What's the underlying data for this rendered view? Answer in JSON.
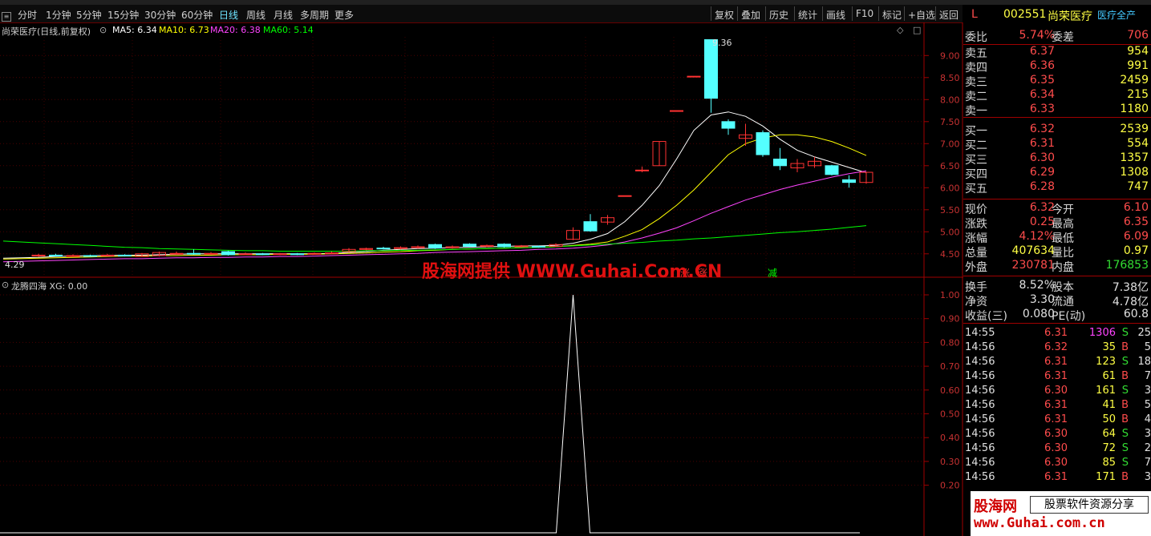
{
  "toolbar": {
    "periods": [
      "分时",
      "1分钟",
      "5分钟",
      "15分钟",
      "30分钟",
      "60分钟",
      "日线",
      "周线",
      "月线",
      "多周期",
      "更多"
    ],
    "active": "日线",
    "right_buttons": [
      "复权",
      "叠加",
      "历史",
      "统计",
      "画线",
      "F10",
      "标记",
      "+自选",
      "返回"
    ]
  },
  "main": {
    "title": "尚荣医疗(日线,前复权)",
    "ma": [
      {
        "label": "MA5: 6.34",
        "color": "#ffffff"
      },
      {
        "label": "MA10: 6.73",
        "color": "#ffff00"
      },
      {
        "label": "MA20: 6.38",
        "color": "#ff44ff"
      },
      {
        "label": "MA60: 5.14",
        "color": "#00ff00"
      }
    ],
    "high_label": "9.36",
    "low_label": "4.29",
    "markers": [
      {
        "text": "涨",
        "color": "#ff3030"
      },
      {
        "text": "涨",
        "color": "#ff3030"
      },
      {
        "text": "减",
        "color": "#00ff00"
      }
    ],
    "watermark": "股海网提供 WWW.Guhai.Com.CN"
  },
  "sub": {
    "title": "龙腾四海 XG: 0.00",
    "yticks": [
      "1.00",
      "0.90",
      "0.80",
      "0.70",
      "0.60",
      "0.50",
      "0.40",
      "0.30",
      "0.20"
    ]
  },
  "chart_data": {
    "type": "candlestick",
    "y_ticks": [
      "9.00",
      "8.50",
      "8.00",
      "7.50",
      "7.00",
      "6.50",
      "6.00",
      "5.50",
      "5.00",
      "4.50"
    ],
    "ylim": [
      4.2,
      9.5
    ],
    "candles": [
      {
        "o": 4.46,
        "c": 4.47,
        "h": 4.5,
        "l": 4.43,
        "up": true
      },
      {
        "o": 4.47,
        "c": 4.46,
        "h": 4.5,
        "l": 4.44,
        "up": false
      },
      {
        "o": 4.45,
        "c": 4.46,
        "h": 4.49,
        "l": 4.43,
        "up": true
      },
      {
        "o": 4.46,
        "c": 4.45,
        "h": 4.48,
        "l": 4.43,
        "up": false
      },
      {
        "o": 4.45,
        "c": 4.47,
        "h": 4.5,
        "l": 4.44,
        "up": true
      },
      {
        "o": 4.47,
        "c": 4.46,
        "h": 4.49,
        "l": 4.44,
        "up": false
      },
      {
        "o": 4.44,
        "c": 4.5,
        "h": 4.52,
        "l": 4.43,
        "up": true
      },
      {
        "o": 4.46,
        "c": 4.53,
        "h": 4.55,
        "l": 4.44,
        "up": true
      },
      {
        "o": 4.5,
        "c": 4.51,
        "h": 4.55,
        "l": 4.48,
        "up": true
      },
      {
        "o": 4.51,
        "c": 4.5,
        "h": 4.6,
        "l": 4.48,
        "up": false
      },
      {
        "o": 4.5,
        "c": 4.51,
        "h": 4.54,
        "l": 4.49,
        "up": true
      },
      {
        "o": 4.55,
        "c": 4.48,
        "h": 4.57,
        "l": 4.46,
        "up": false
      },
      {
        "o": 4.49,
        "c": 4.5,
        "h": 4.53,
        "l": 4.47,
        "up": true
      },
      {
        "o": 4.5,
        "c": 4.49,
        "h": 4.52,
        "l": 4.47,
        "up": false
      },
      {
        "o": 4.49,
        "c": 4.5,
        "h": 4.52,
        "l": 4.47,
        "up": true
      },
      {
        "o": 4.5,
        "c": 4.49,
        "h": 4.52,
        "l": 4.47,
        "up": false
      },
      {
        "o": 4.49,
        "c": 4.51,
        "h": 4.53,
        "l": 4.48,
        "up": true
      },
      {
        "o": 4.5,
        "c": 4.52,
        "h": 4.55,
        "l": 4.49,
        "up": true
      },
      {
        "o": 4.55,
        "c": 4.6,
        "h": 4.63,
        "l": 4.53,
        "up": true
      },
      {
        "o": 4.6,
        "c": 4.62,
        "h": 4.64,
        "l": 4.58,
        "up": true
      },
      {
        "o": 4.63,
        "c": 4.62,
        "h": 4.66,
        "l": 4.6,
        "up": false
      },
      {
        "o": 4.62,
        "c": 4.64,
        "h": 4.67,
        "l": 4.6,
        "up": true
      },
      {
        "o": 4.66,
        "c": 4.64,
        "h": 4.69,
        "l": 4.62,
        "up": true
      },
      {
        "o": 4.71,
        "c": 4.63,
        "h": 4.73,
        "l": 4.61,
        "up": false
      },
      {
        "o": 4.64,
        "c": 4.66,
        "h": 4.69,
        "l": 4.62,
        "up": true
      },
      {
        "o": 4.72,
        "c": 4.67,
        "h": 4.74,
        "l": 4.65,
        "up": false
      },
      {
        "o": 4.67,
        "c": 4.69,
        "h": 4.71,
        "l": 4.65,
        "up": true
      },
      {
        "o": 4.72,
        "c": 4.66,
        "h": 4.74,
        "l": 4.64,
        "up": false
      },
      {
        "o": 4.66,
        "c": 4.68,
        "h": 4.7,
        "l": 4.64,
        "up": true
      },
      {
        "o": 4.67,
        "c": 4.66,
        "h": 4.69,
        "l": 4.64,
        "up": false
      },
      {
        "o": 4.67,
        "c": 4.71,
        "h": 4.74,
        "l": 4.65,
        "up": true
      },
      {
        "o": 4.83,
        "c": 5.03,
        "h": 5.1,
        "l": 4.81,
        "up": true
      },
      {
        "o": 5.23,
        "c": 5.02,
        "h": 5.4,
        "l": 5.0,
        "up": false
      },
      {
        "o": 5.22,
        "c": 5.32,
        "h": 5.38,
        "l": 5.16,
        "up": true
      },
      {
        "o": 5.82,
        "c": 5.82,
        "h": 5.82,
        "l": 5.82,
        "up": true
      },
      {
        "o": 6.4,
        "c": 6.4,
        "h": 6.48,
        "l": 6.35,
        "up": true
      },
      {
        "o": 6.5,
        "c": 7.05,
        "h": 7.05,
        "l": 6.5,
        "up": true
      },
      {
        "o": 7.75,
        "c": 7.75,
        "h": 7.75,
        "l": 7.75,
        "up": true
      },
      {
        "o": 8.53,
        "c": 8.53,
        "h": 8.53,
        "l": 8.53,
        "up": true
      },
      {
        "o": 9.36,
        "c": 8.03,
        "h": 9.36,
        "l": 7.7,
        "up": false
      },
      {
        "o": 7.5,
        "c": 7.35,
        "h": 7.55,
        "l": 7.2,
        "up": false
      },
      {
        "o": 7.12,
        "c": 7.2,
        "h": 7.45,
        "l": 6.95,
        "up": true
      },
      {
        "o": 7.25,
        "c": 6.75,
        "h": 7.3,
        "l": 6.7,
        "up": false
      },
      {
        "o": 6.65,
        "c": 6.5,
        "h": 6.9,
        "l": 6.4,
        "up": false
      },
      {
        "o": 6.45,
        "c": 6.55,
        "h": 6.65,
        "l": 6.35,
        "up": true
      },
      {
        "o": 6.5,
        "c": 6.6,
        "h": 6.7,
        "l": 6.45,
        "up": true
      },
      {
        "o": 6.5,
        "c": 6.3,
        "h": 6.52,
        "l": 6.28,
        "up": false
      },
      {
        "o": 6.18,
        "c": 6.12,
        "h": 6.28,
        "l": 6.0,
        "up": false
      },
      {
        "o": 6.12,
        "c": 6.35,
        "h": 6.35,
        "l": 6.09,
        "up": true
      }
    ],
    "ma_series": [
      {
        "name": "MA5",
        "color": "#ffffff",
        "values": [
          4.42,
          4.44,
          4.45,
          4.46,
          4.46,
          4.47,
          4.47,
          4.48,
          4.49,
          4.5,
          4.5,
          4.5,
          4.5,
          4.5,
          4.5,
          4.5,
          4.5,
          4.51,
          4.53,
          4.55,
          4.58,
          4.6,
          4.62,
          4.63,
          4.64,
          4.65,
          4.66,
          4.67,
          4.68,
          4.68,
          4.69,
          4.74,
          4.83,
          4.96,
          5.23,
          5.6,
          6.05,
          6.65,
          7.3,
          7.65,
          7.72,
          7.62,
          7.4,
          7.1,
          6.85,
          6.7,
          6.58,
          6.46,
          6.34
        ]
      },
      {
        "name": "MA10",
        "color": "#ffff00",
        "values": [
          4.4,
          4.41,
          4.42,
          4.43,
          4.44,
          4.45,
          4.45,
          4.46,
          4.46,
          4.47,
          4.47,
          4.48,
          4.48,
          4.48,
          4.49,
          4.49,
          4.49,
          4.5,
          4.51,
          4.52,
          4.54,
          4.55,
          4.57,
          4.58,
          4.6,
          4.61,
          4.62,
          4.63,
          4.64,
          4.65,
          4.66,
          4.69,
          4.72,
          4.77,
          4.9,
          5.05,
          5.3,
          5.6,
          5.95,
          6.35,
          6.75,
          7.0,
          7.13,
          7.2,
          7.2,
          7.15,
          7.05,
          6.9,
          6.73
        ]
      },
      {
        "name": "MA20",
        "color": "#ff44ff",
        "values": [
          4.34,
          4.35,
          4.36,
          4.37,
          4.38,
          4.39,
          4.39,
          4.4,
          4.41,
          4.41,
          4.42,
          4.42,
          4.43,
          4.43,
          4.44,
          4.44,
          4.45,
          4.46,
          4.47,
          4.48,
          4.49,
          4.5,
          4.51,
          4.53,
          4.54,
          4.55,
          4.56,
          4.57,
          4.58,
          4.6,
          4.61,
          4.63,
          4.66,
          4.7,
          4.77,
          4.86,
          4.97,
          5.09,
          5.25,
          5.42,
          5.57,
          5.72,
          5.84,
          5.96,
          6.06,
          6.15,
          6.24,
          6.32,
          6.38
        ]
      },
      {
        "name": "MA60",
        "color": "#00ff00",
        "values": [
          4.75,
          4.73,
          4.71,
          4.69,
          4.67,
          4.65,
          4.64,
          4.62,
          4.61,
          4.6,
          4.59,
          4.58,
          4.57,
          4.57,
          4.56,
          4.56,
          4.56,
          4.56,
          4.56,
          4.57,
          4.57,
          4.58,
          4.58,
          4.59,
          4.6,
          4.61,
          4.62,
          4.63,
          4.64,
          4.65,
          4.66,
          4.68,
          4.7,
          4.72,
          4.74,
          4.76,
          4.79,
          4.81,
          4.84,
          4.86,
          4.89,
          4.92,
          4.95,
          4.98,
          5.0,
          5.03,
          5.06,
          5.1,
          5.14
        ]
      }
    ],
    "indicator": {
      "name": "XG",
      "values_peak_index": 31,
      "ylim": [
        0,
        1.05
      ]
    }
  },
  "quote": {
    "code": "002551",
    "name": "尚荣医疗",
    "sector": "医疗全产",
    "webi_label": "委比",
    "webi": "5.74%",
    "weicha_label": "委差",
    "weicha": "706",
    "sells": [
      {
        "label": "卖五",
        "price": "6.37",
        "vol": "954"
      },
      {
        "label": "卖四",
        "price": "6.36",
        "vol": "991"
      },
      {
        "label": "卖三",
        "price": "6.35",
        "vol": "2459"
      },
      {
        "label": "卖二",
        "price": "6.34",
        "vol": "215"
      },
      {
        "label": "卖一",
        "price": "6.33",
        "vol": "1180"
      }
    ],
    "buys": [
      {
        "label": "买一",
        "price": "6.32",
        "vol": "2539"
      },
      {
        "label": "买二",
        "price": "6.31",
        "vol": "554"
      },
      {
        "label": "买三",
        "price": "6.30",
        "vol": "1357"
      },
      {
        "label": "买四",
        "price": "6.29",
        "vol": "1308"
      },
      {
        "label": "买五",
        "price": "6.28",
        "vol": "747"
      }
    ],
    "stats": [
      {
        "l1": "现价",
        "v1": "6.32",
        "c1": "red",
        "l2": "今开",
        "v2": "6.10",
        "c2": "red"
      },
      {
        "l1": "涨跌",
        "v1": "0.25",
        "c1": "red",
        "l2": "最高",
        "v2": "6.35",
        "c2": "red"
      },
      {
        "l1": "涨幅",
        "v1": "4.12%",
        "c1": "red",
        "l2": "最低",
        "v2": "6.09",
        "c2": "red"
      },
      {
        "l1": "总量",
        "v1": "407634",
        "c1": "yel",
        "l2": "量比",
        "v2": "0.97",
        "c2": "yel"
      },
      {
        "l1": "外盘",
        "v1": "230781",
        "c1": "red",
        "l2": "内盘",
        "v2": "176853",
        "c2": "grn"
      }
    ],
    "fund": [
      {
        "l1": "换手",
        "v1": "8.52%",
        "l2": "股本",
        "v2": "7.38亿"
      },
      {
        "l1": "净资",
        "v1": "3.30",
        "l2": "流通",
        "v2": "4.78亿"
      },
      {
        "l1": "收益(三)",
        "v1": "0.080",
        "l2": "PE(动)",
        "v2": "60.8"
      }
    ],
    "ticks": [
      {
        "t": "14:55",
        "p": "6.31",
        "v": "1306",
        "bs": "S",
        "n": "25",
        "vc": "mag"
      },
      {
        "t": "14:56",
        "p": "6.32",
        "v": "35",
        "bs": "B",
        "n": "5",
        "vc": "yel"
      },
      {
        "t": "14:56",
        "p": "6.31",
        "v": "123",
        "bs": "S",
        "n": "18",
        "vc": "yel"
      },
      {
        "t": "14:56",
        "p": "6.31",
        "v": "61",
        "bs": "B",
        "n": "7",
        "vc": "yel"
      },
      {
        "t": "14:56",
        "p": "6.30",
        "v": "161",
        "bs": "S",
        "n": "3",
        "vc": "yel"
      },
      {
        "t": "14:56",
        "p": "6.31",
        "v": "41",
        "bs": "B",
        "n": "5",
        "vc": "yel"
      },
      {
        "t": "14:56",
        "p": "6.31",
        "v": "50",
        "bs": "B",
        "n": "4",
        "vc": "yel"
      },
      {
        "t": "14:56",
        "p": "6.30",
        "v": "64",
        "bs": "S",
        "n": "3",
        "vc": "yel"
      },
      {
        "t": "14:56",
        "p": "6.30",
        "v": "72",
        "bs": "S",
        "n": "2",
        "vc": "yel"
      },
      {
        "t": "14:56",
        "p": "6.30",
        "v": "85",
        "bs": "S",
        "n": "7",
        "vc": "yel"
      },
      {
        "t": "14:56",
        "p": "6.31",
        "v": "171",
        "bs": "B",
        "n": "3",
        "vc": "yel"
      }
    ],
    "brand_title": "股海网",
    "brand_sub": "股票软件资源分享",
    "brand_url": "www.Guhai.com.cn"
  }
}
